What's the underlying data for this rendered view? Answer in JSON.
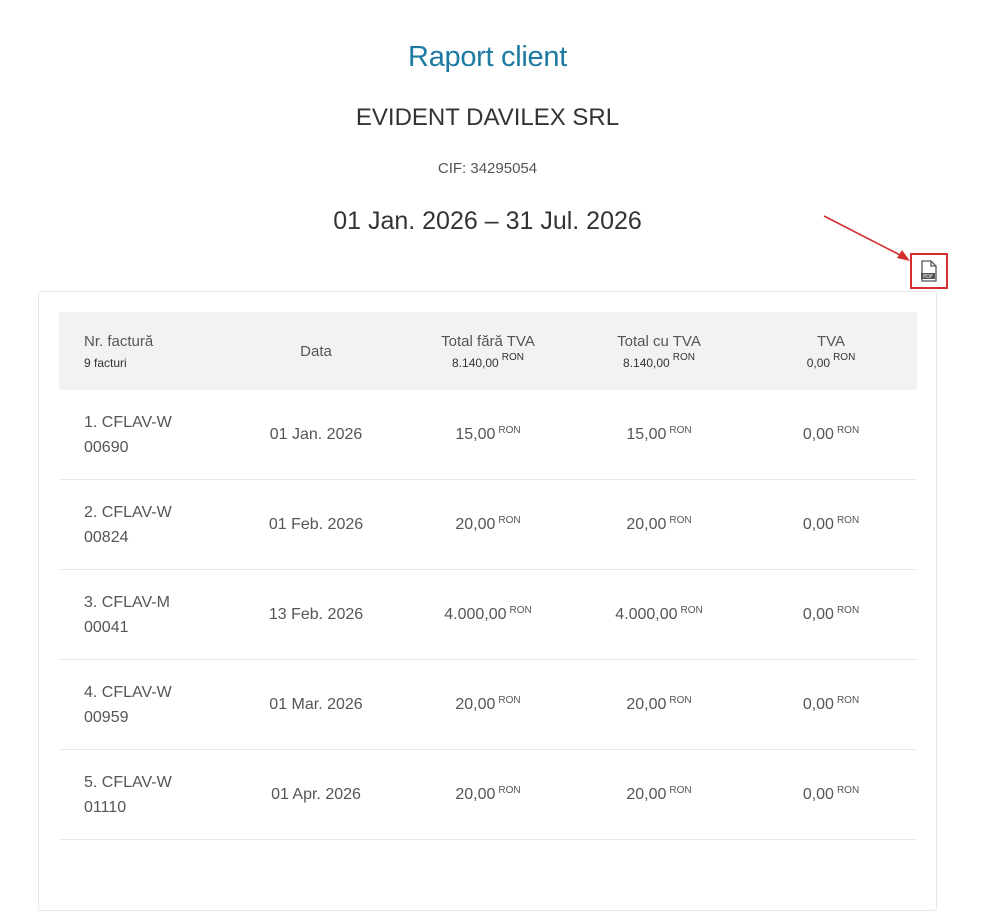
{
  "page": {
    "title": "Raport client",
    "company": "EVIDENT DAVILEX SRL",
    "cif": "CIF: 34295054",
    "period": "01 Jan. 2026 – 31 Jul. 2026"
  },
  "toolbar": {
    "pdf_icon": "pdf-file-icon",
    "pdf_label": "PDF",
    "annotation_color": "#d32f2f"
  },
  "table": {
    "headers": {
      "invoice_no": "Nr. factură",
      "invoice_count": "9 facturi",
      "date": "Data",
      "total_no_vat": "Total fără TVA",
      "total_no_vat_sum": "8.140,00",
      "total_with_vat": "Total cu TVA",
      "total_with_vat_sum": "8.140,00",
      "vat": "TVA",
      "vat_sum": "0,00",
      "currency": "RON"
    },
    "rows": [
      {
        "line1": "1. CFLAV-W",
        "line2": "00690",
        "date": "01 Jan. 2026",
        "net": "15,00",
        "gross": "15,00",
        "vat": "0,00",
        "currency": "RON"
      },
      {
        "line1": "2. CFLAV-W",
        "line2": "00824",
        "date": "01 Feb. 2026",
        "net": "20,00",
        "gross": "20,00",
        "vat": "0,00",
        "currency": "RON"
      },
      {
        "line1": "3. CFLAV-M",
        "line2": "00041",
        "date": "13 Feb. 2026",
        "net": "4.000,00",
        "gross": "4.000,00",
        "vat": "0,00",
        "currency": "RON"
      },
      {
        "line1": "4. CFLAV-W",
        "line2": "00959",
        "date": "01 Mar. 2026",
        "net": "20,00",
        "gross": "20,00",
        "vat": "0,00",
        "currency": "RON"
      },
      {
        "line1": "5. CFLAV-W",
        "line2": "01110",
        "date": "01 Apr. 2026",
        "net": "20,00",
        "gross": "20,00",
        "vat": "0,00",
        "currency": "RON"
      }
    ]
  }
}
